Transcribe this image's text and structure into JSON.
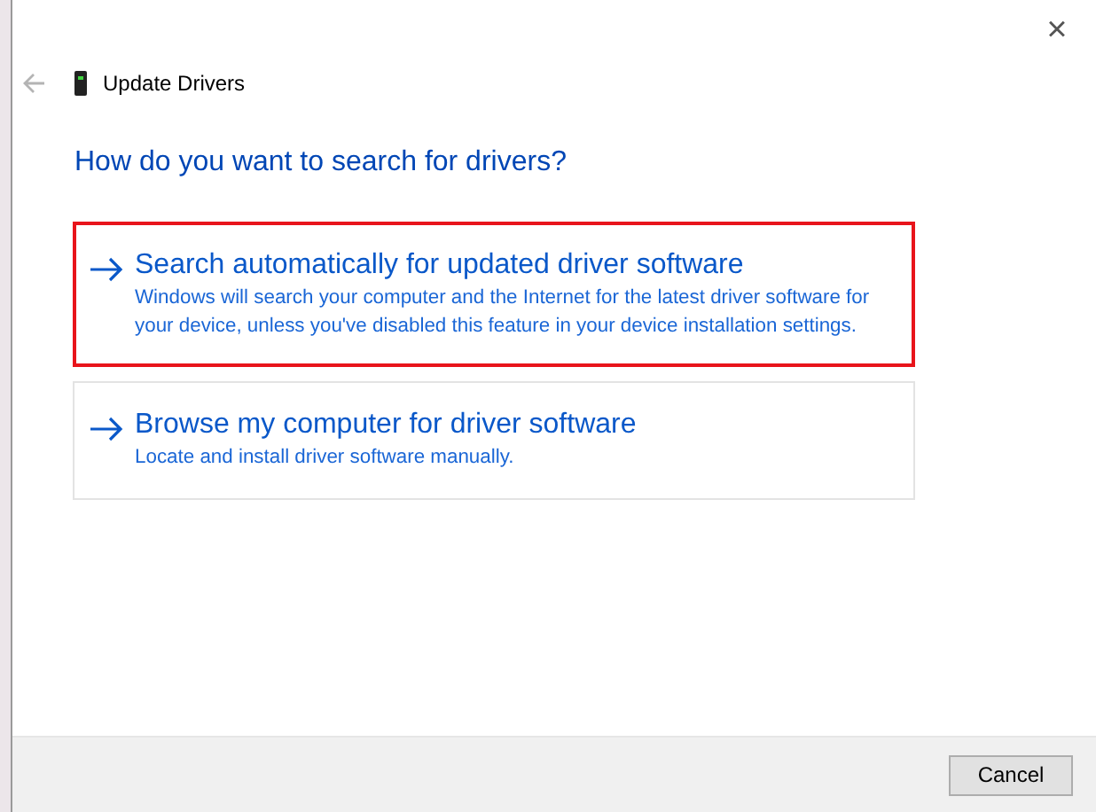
{
  "window": {
    "title": "Update Drivers",
    "close": "×"
  },
  "heading": "How do you want to search for drivers?",
  "options": [
    {
      "title": "Search automatically for updated driver software",
      "description": "Windows will search your computer and the Internet for the latest driver software for your device, unless you've disabled this feature in your device installation settings.",
      "highlighted": true
    },
    {
      "title": "Browse my computer for driver software",
      "description": "Locate and install driver software manually.",
      "highlighted": false
    }
  ],
  "buttons": [
    "Cancel"
  ]
}
